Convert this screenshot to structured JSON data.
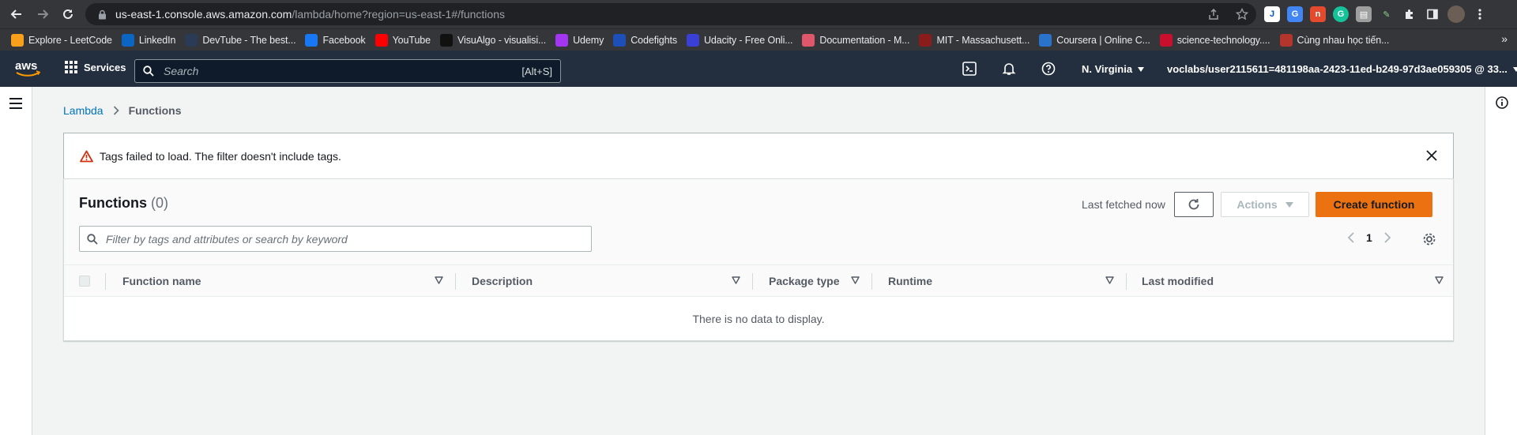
{
  "browser": {
    "url_host": "us-east-1.console.aws.amazon.com",
    "url_path": "/lambda/home?region=us-east-1#/functions",
    "bookmarks": [
      {
        "label": "Explore - LeetCode",
        "icon": "leetcode-icon",
        "color": "#f89f1b"
      },
      {
        "label": "LinkedIn",
        "icon": "linkedin-icon",
        "color": "#0a66c2"
      },
      {
        "label": "DevTube - The best...",
        "icon": "devtube-icon",
        "color": "#2b3a55"
      },
      {
        "label": "Facebook",
        "icon": "facebook-icon",
        "color": "#1877f2"
      },
      {
        "label": "YouTube",
        "icon": "youtube-icon",
        "color": "#ff0000"
      },
      {
        "label": "VisuAlgo - visualisi...",
        "icon": "visualgo-icon",
        "color": "#111111"
      },
      {
        "label": "Udemy",
        "icon": "udemy-icon",
        "color": "#a435f0"
      },
      {
        "label": "Codefights",
        "icon": "codefights-icon",
        "color": "#1d4fb8"
      },
      {
        "label": "Udacity - Free Onli...",
        "icon": "udacity-icon",
        "color": "#3a3fd6"
      },
      {
        "label": "Documentation - M...",
        "icon": "mui-icon",
        "color": "#e0566b"
      },
      {
        "label": "MIT - Massachusett...",
        "icon": "mit-icon",
        "color": "#8a1c1c"
      },
      {
        "label": "Coursera | Online C...",
        "icon": "coursera-icon",
        "color": "#2a73cc"
      },
      {
        "label": "science-technology....",
        "icon": "science-icon",
        "color": "#c8102e"
      },
      {
        "label": "Cùng nhau học tiến...",
        "icon": "calendar-icon",
        "color": "#b4352c"
      }
    ],
    "more_label": "»"
  },
  "aws_header": {
    "logo_text": "aws",
    "services_label": "Services",
    "search_placeholder": "Search",
    "search_shortcut": "[Alt+S]",
    "region_label": "N. Virginia",
    "account_label": "voclabs/user2115611=481198aa-2423-11ed-b249-97d3ae059305 @ 33..."
  },
  "breadcrumb": {
    "root": "Lambda",
    "current": "Functions"
  },
  "alert": {
    "message": "Tags failed to load. The filter doesn't include tags."
  },
  "functions": {
    "title": "Functions",
    "count": "(0)",
    "last_fetched": "Last fetched now",
    "actions_label": "Actions",
    "create_label": "Create function",
    "filter_placeholder": "Filter by tags and attributes or search by keyword",
    "page_number": "1",
    "columns": [
      "Function name",
      "Description",
      "Package type",
      "Runtime",
      "Last modified"
    ],
    "empty_message": "There is no data to display."
  },
  "colors": {
    "aws_nav": "#232f3e",
    "primary_button": "#ec7211",
    "link": "#0073bb",
    "warning": "#d13212"
  }
}
